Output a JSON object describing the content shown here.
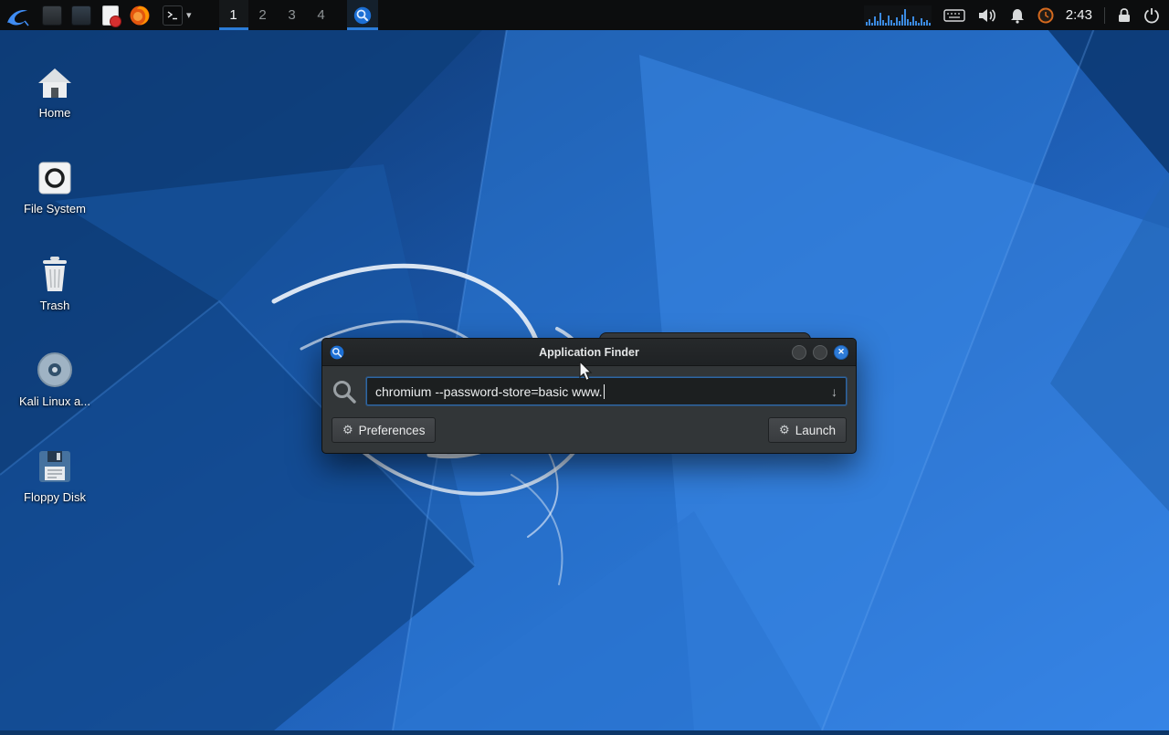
{
  "panel": {
    "workspaces": [
      {
        "label": "1",
        "active": true
      },
      {
        "label": "2",
        "active": false
      },
      {
        "label": "3",
        "active": false
      },
      {
        "label": "4",
        "active": false
      }
    ],
    "clock": "2:43"
  },
  "desktop": {
    "icons": [
      {
        "label": "Home"
      },
      {
        "label": "File System"
      },
      {
        "label": "Trash"
      },
      {
        "label": "Kali Linux a..."
      },
      {
        "label": "Floppy Disk"
      }
    ]
  },
  "finder": {
    "title": "Application Finder",
    "command": "chromium --password-store=basic www.",
    "preferences_label": "Preferences",
    "launch_label": "Launch"
  },
  "icons": {
    "gear": "⚙",
    "down_arrow": "↓",
    "close": "✕",
    "chevron_down": "▾"
  },
  "colors": {
    "accent": "#2b7cd8",
    "panel_bg": "#0c0d0e",
    "dialog_bg": "#323638",
    "input_border": "#2d66a5",
    "wallpaper_blue": "#2f7ee3"
  }
}
